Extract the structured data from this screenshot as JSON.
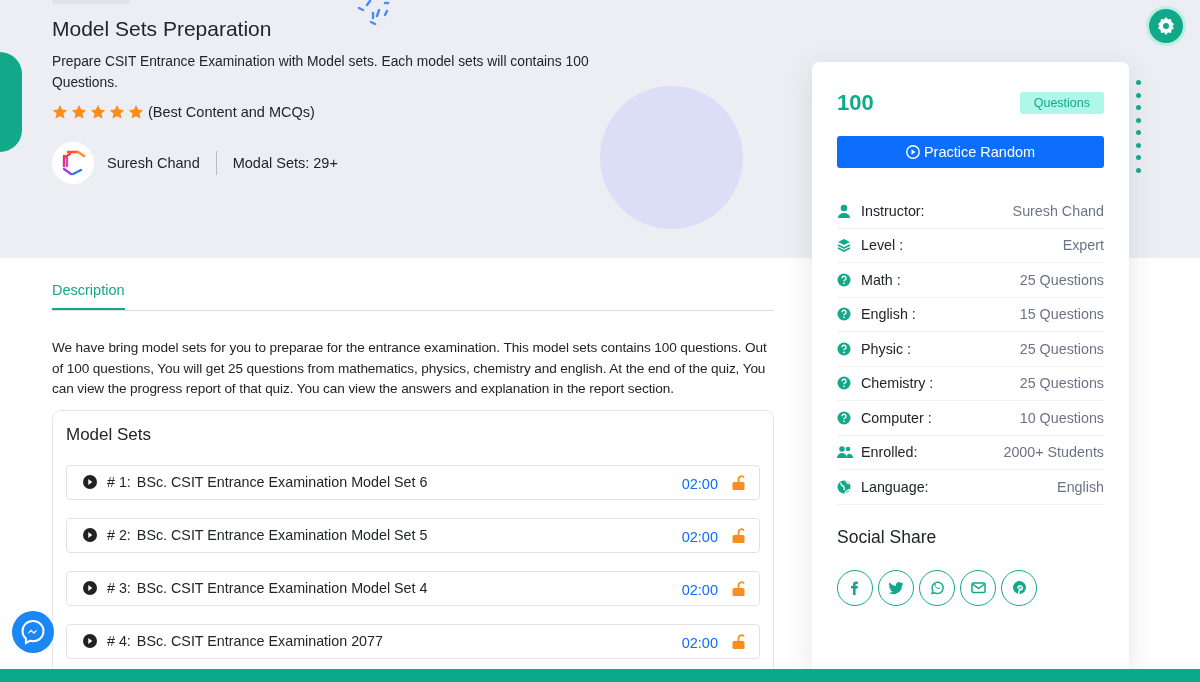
{
  "hero": {
    "title": "Model Sets Preparation",
    "subtitle": "Prepare CSIT Entrance Examination with Model sets. Each model sets will contains 100 Questions.",
    "stars": 5,
    "rating_note": "(Best Content and MCQs)",
    "author": "Suresh Chand",
    "sets_count": "Modal Sets: 29+"
  },
  "tabs": [
    {
      "label": "Description",
      "selected": true
    }
  ],
  "description": "We have bring model sets for you to preparae for the entrance examination. This model sets contains 100 questions. Out of 100 questions, You will get 25 questions from mathematics, physics, chemistry and english. At the end of the quiz, You can view the progress report of that quiz. You can view the answers and explanation in the report section.",
  "model_sets": {
    "title": "Model Sets",
    "items": [
      {
        "number": "# 1:",
        "name": "BSc. CSIT Entrance Examination Model Set 6",
        "time": "02:00",
        "locked": false
      },
      {
        "number": "# 2:",
        "name": "BSc. CSIT Entrance Examination Model Set 5",
        "time": "02:00",
        "locked": false
      },
      {
        "number": "# 3:",
        "name": "BSc. CSIT Entrance Examination Model Set 4",
        "time": "02:00",
        "locked": false
      },
      {
        "number": "# 4:",
        "name": "BSc. CSIT Entrance Examination 2077",
        "time": "02:00",
        "locked": false
      }
    ]
  },
  "card": {
    "count": "100",
    "badge": "Questions",
    "button": "Practice Random",
    "details": [
      {
        "kind": "person",
        "label": "Instructor:",
        "value": "Suresh Chand"
      },
      {
        "kind": "layers",
        "label": "Level :",
        "value": "Expert"
      },
      {
        "kind": "question",
        "label": "Math :",
        "value": "25 Questions"
      },
      {
        "kind": "question",
        "label": "English :",
        "value": "15 Questions"
      },
      {
        "kind": "question",
        "label": "Physic :",
        "value": "25 Questions"
      },
      {
        "kind": "question",
        "label": "Chemistry :",
        "value": "25 Questions"
      },
      {
        "kind": "question",
        "label": "Computer :",
        "value": "10 Questions"
      },
      {
        "kind": "people",
        "label": "Enrolled:",
        "value": "2000+ Students"
      },
      {
        "kind": "globe",
        "label": "Language:",
        "value": "English"
      }
    ],
    "share_title": "Social Share"
  }
}
